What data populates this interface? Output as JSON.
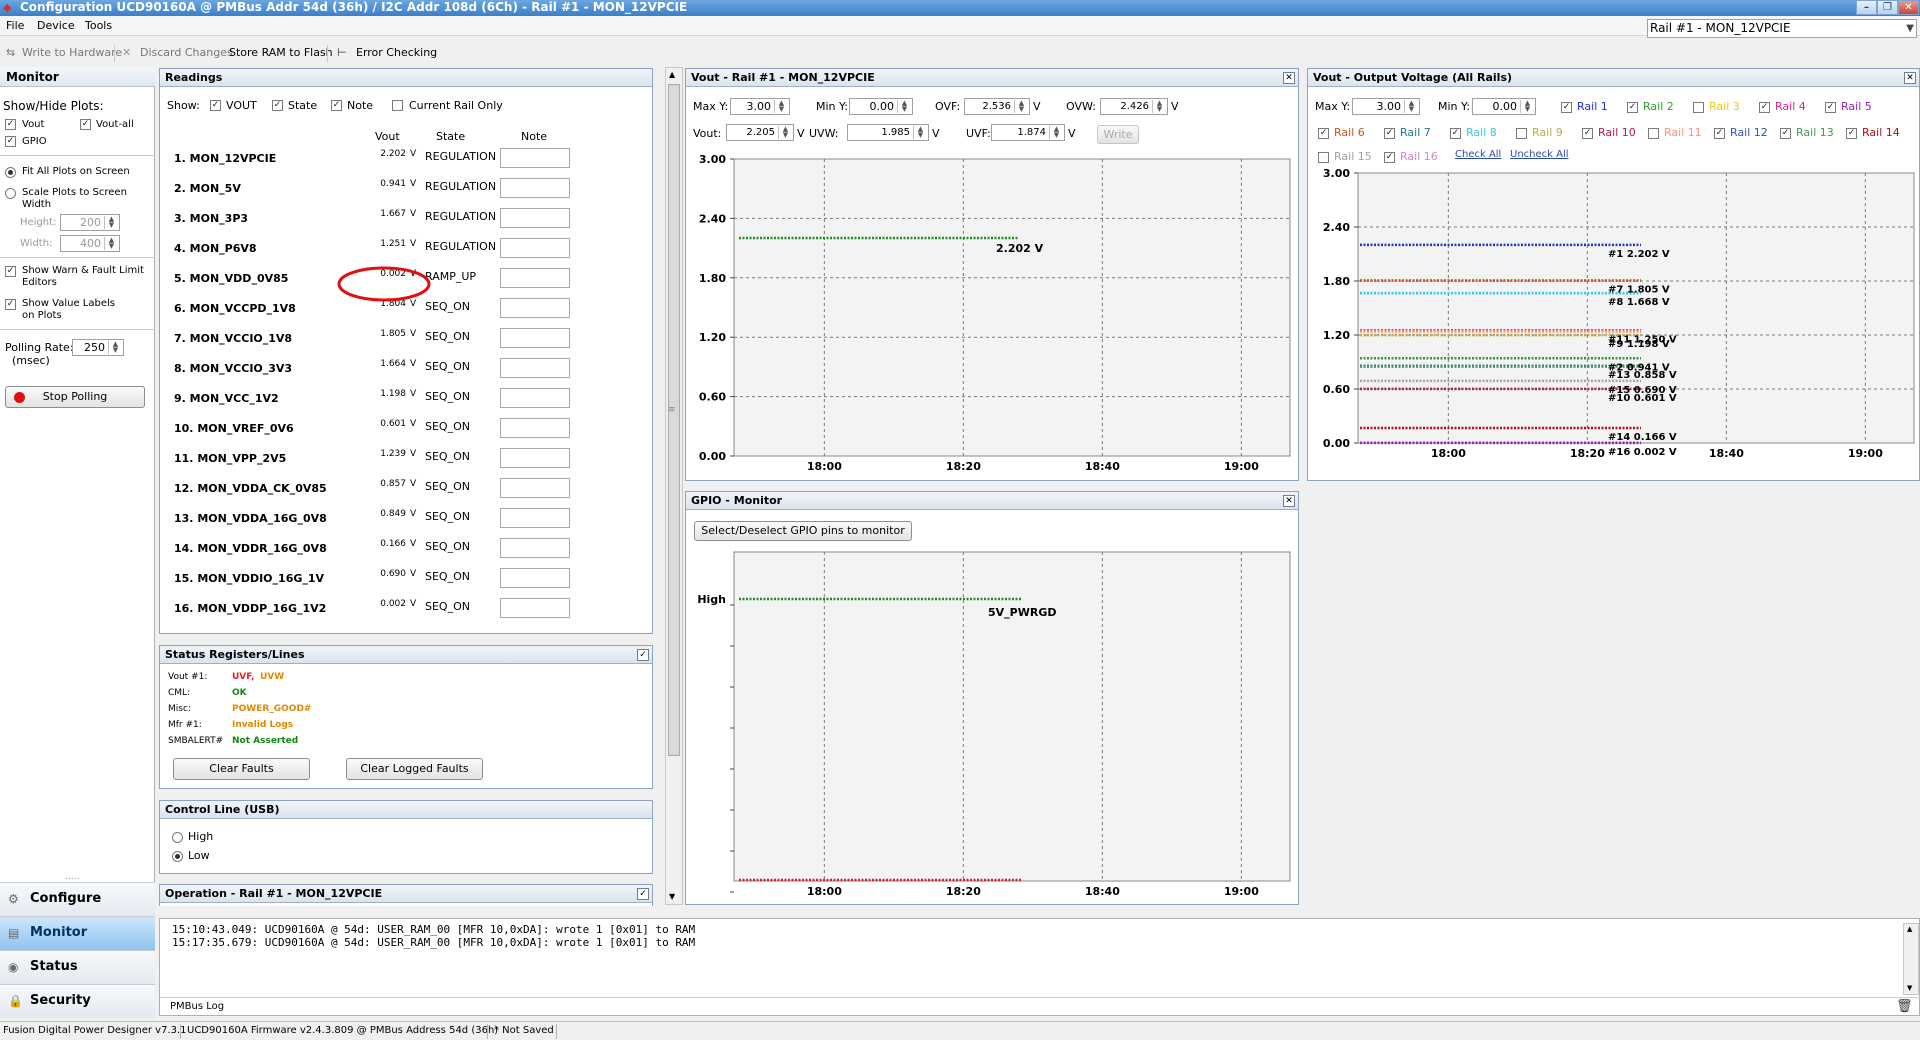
{
  "window": {
    "title": "Configuration UCD90160A @ PMBus Addr 54d (36h) / I2C Addr 108d (6Ch)  - Rail #1 - MON_12VPCIE",
    "minimize": "–",
    "restore": "❐",
    "close": "✕"
  },
  "menu": {
    "file": "File",
    "device": "Device",
    "tools": "Tools"
  },
  "rail_selector": {
    "value": "Rail #1 - MON_12VPCIE"
  },
  "toolbar": {
    "write_to_hardware": "Write to Hardware",
    "discard_changes": "Discard Changes",
    "store_ram_to_flash": "Store RAM to Flash",
    "error_checking": "Error Checking"
  },
  "left": {
    "header": "Monitor",
    "show_hide_label": "Show/Hide Plots:",
    "cb_vout": "Vout",
    "cb_voutall": "Vout-all",
    "cb_gpio": "GPIO",
    "fit_all": "Fit All Plots on Screen",
    "scale_plots": "Scale Plots to Screen",
    "scale_plots2": "Width",
    "height_label": "Height:",
    "height_value": "200",
    "width_label": "Width:",
    "width_value": "400",
    "warn_fault": "Show Warn & Fault Limit",
    "warn_fault2": "Editors",
    "value_labels": "Show Value Labels",
    "value_labels2": "on Plots",
    "polling_label": "Polling Rate:",
    "polling_unit": "(msec)",
    "polling_value": "250",
    "stop_polling": "Stop Polling",
    "grip": "....."
  },
  "nav": {
    "configure": "Configure",
    "monitor": "Monitor",
    "status": "Status",
    "security": "Security"
  },
  "readings": {
    "title": "Readings",
    "show_label": "Show:",
    "show_vout": "VOUT",
    "show_state": "State",
    "show_note": "Note",
    "show_current": "Current Rail Only",
    "col_vout": "Vout",
    "col_state": "State",
    "col_note": "Note",
    "unit": "V",
    "rows": [
      {
        "name": "1. MON_12VPCIE",
        "vout": "2.202",
        "state": "REGULATION"
      },
      {
        "name": "2. MON_5V",
        "vout": "0.941",
        "state": "REGULATION"
      },
      {
        "name": "3. MON_3P3",
        "vout": "1.667",
        "state": "REGULATION"
      },
      {
        "name": "4. MON_P6V8",
        "vout": "1.251",
        "state": "REGULATION"
      },
      {
        "name": "5. MON_VDD_0V85",
        "vout": "0.002",
        "state": "RAMP_UP"
      },
      {
        "name": "6. MON_VCCPD_1V8",
        "vout": "1.804",
        "state": "SEQ_ON"
      },
      {
        "name": "7. MON_VCCIO_1V8",
        "vout": "1.805",
        "state": "SEQ_ON"
      },
      {
        "name": "8. MON_VCCIO_3V3",
        "vout": "1.664",
        "state": "SEQ_ON"
      },
      {
        "name": "9. MON_VCC_1V2",
        "vout": "1.198",
        "state": "SEQ_ON"
      },
      {
        "name": "10. MON_VREF_0V6",
        "vout": "0.601",
        "state": "SEQ_ON"
      },
      {
        "name": "11. MON_VPP_2V5",
        "vout": "1.239",
        "state": "SEQ_ON"
      },
      {
        "name": "12. MON_VDDA_CK_0V85",
        "vout": "0.857",
        "state": "SEQ_ON"
      },
      {
        "name": "13. MON_VDDA_16G_0V8",
        "vout": "0.849",
        "state": "SEQ_ON"
      },
      {
        "name": "14. MON_VDDR_16G_0V8",
        "vout": "0.166",
        "state": "SEQ_ON"
      },
      {
        "name": "15. MON_VDDIO_16G_1V",
        "vout": "0.690",
        "state": "SEQ_ON"
      },
      {
        "name": "16. MON_VDDP_16G_1V2",
        "vout": "0.002",
        "state": "SEQ_ON"
      }
    ]
  },
  "status_regs": {
    "title": "Status Registers/Lines",
    "vout_label": "Vout #1:",
    "vout_v1": "UVF,",
    "vout_v2": "UVW",
    "cml_label": "CML:",
    "cml_value": "OK",
    "misc_label": "Misc:",
    "misc_value": "POWER_GOOD#",
    "mfr_label": "Mfr #1:",
    "mfr_value": "Invalid Logs",
    "smb_label": "SMBALERT#",
    "smb_value": "Not Asserted",
    "clear_faults": "Clear Faults",
    "clear_logged": "Clear Logged Faults",
    "colors": {
      "red": "#dd2222",
      "orange": "#e08800",
      "green": "#118811"
    }
  },
  "control_line": {
    "title": "Control Line (USB)",
    "high": "High",
    "low": "Low"
  },
  "operation": {
    "title": "Operation - Rail #1 - MON_12VPCIE"
  },
  "vout_plot": {
    "title": "Vout - Rail #1 - MON_12VPCIE",
    "maxy_label": "Max Y:",
    "maxy": "3.00",
    "miny_label": "Min Y:",
    "miny": "0.00",
    "ovf_label": "OVF:",
    "ovf": "2.536",
    "ovw_label": "OVW:",
    "ovw": "2.426",
    "vout_label": "Vout:",
    "vout": "2.205",
    "uvw_label": "UVW:",
    "uvw": "1.985",
    "uvf_label": "UVF:",
    "uvf": "1.874",
    "unit": "V",
    "write": "Write",
    "value_label": "2.202 V"
  },
  "gpio_plot": {
    "title": "GPIO - Monitor",
    "select_button": "Select/Deselect GPIO pins to monitor",
    "high_label": "High",
    "signal_label": "5V_PWRGD"
  },
  "all_plot": {
    "title": "Vout - Output Voltage (All Rails)",
    "maxy_label": "Max Y:",
    "maxy": "3.00",
    "miny_label": "Min Y:",
    "miny": "0.00",
    "check_all": "Check All",
    "uncheck_all": "Uncheck All",
    "rails": [
      {
        "label": "Rail 1",
        "color": "#2233cc",
        "checked": true
      },
      {
        "label": "Rail 2",
        "color": "#339933",
        "checked": true
      },
      {
        "label": "Rail 3",
        "color": "#e8c820",
        "checked": false
      },
      {
        "label": "Rail 4",
        "color": "#dd2288",
        "checked": true
      },
      {
        "label": "Rail 5",
        "color": "#9922bb",
        "checked": true
      },
      {
        "label": "Rail 6",
        "color": "#cc5522",
        "checked": true
      },
      {
        "label": "Rail 7",
        "color": "#227788",
        "checked": true
      },
      {
        "label": "Rail 8",
        "color": "#33ccdd",
        "checked": true
      },
      {
        "label": "Rail 9",
        "color": "#bbaa55",
        "checked": false
      },
      {
        "label": "Rail 10",
        "color": "#aa2244",
        "checked": true
      },
      {
        "label": "Rail 11",
        "color": "#ee9977",
        "checked": false
      },
      {
        "label": "Rail 12",
        "color": "#3355aa",
        "checked": true
      },
      {
        "label": "Rail 13",
        "color": "#449955",
        "checked": true
      },
      {
        "label": "Rail 14",
        "color": "#aa1111",
        "checked": true
      },
      {
        "label": "Rail 15",
        "color": "#99aa99",
        "checked": false
      },
      {
        "label": "Rail 16",
        "color": "#cc88cc",
        "checked": true
      }
    ],
    "value_labels": [
      "#1 2.202 V",
      "#7 1.805 V",
      "#8 1.668 V",
      "#11 1.250 V",
      "#9 1.198 V",
      "#2 0.941 V",
      "#13 0.858 V",
      "#15 0.690 V",
      "#10 0.601 V",
      "#14 0.166 V",
      "#16 0.002 V"
    ]
  },
  "chart_data": [
    {
      "type": "line",
      "title": "Vout - Rail #1 - MON_12VPCIE",
      "ylim": [
        0,
        3
      ],
      "yticks": [
        "3.00",
        "2.40",
        "1.80",
        "1.20",
        "0.60",
        "0.00"
      ],
      "xticks": [
        "18:00",
        "18:20",
        "18:40",
        "19:00"
      ],
      "series": [
        {
          "name": "Rail #1",
          "color": "#228822",
          "x": [
            "17:54",
            "18:30"
          ],
          "values": [
            2.202,
            2.202
          ]
        }
      ]
    },
    {
      "type": "line",
      "title": "GPIO - Monitor",
      "xticks": [
        "18:00",
        "18:20",
        "18:40",
        "19:00"
      ],
      "yticks": [
        "High"
      ],
      "series": [
        {
          "name": "5V_PWRGD",
          "color": "#228822",
          "x": [
            "17:54",
            "18:30"
          ],
          "values": [
            1,
            1
          ]
        },
        {
          "color": "#cc2222",
          "x": [
            "17:54",
            "18:30"
          ],
          "values": [
            0,
            0
          ]
        }
      ]
    },
    {
      "type": "line",
      "title": "Vout - Output Voltage (All Rails)",
      "ylim": [
        0,
        3
      ],
      "yticks": [
        "3.00",
        "2.40",
        "1.80",
        "1.20",
        "0.60",
        "0.00"
      ],
      "xticks": [
        "18:00",
        "18:20",
        "18:40",
        "19:00"
      ],
      "series": [
        {
          "name": "#1",
          "color": "#2233cc",
          "values": [
            2.202,
            2.202
          ]
        },
        {
          "name": "#7",
          "color": "#227788",
          "values": [
            1.805,
            1.805
          ]
        },
        {
          "name": "#6",
          "color": "#cc5522",
          "values": [
            1.804,
            1.804
          ]
        },
        {
          "name": "#3",
          "color": "#e8c820",
          "values": [
            1.667,
            1.667
          ]
        },
        {
          "name": "#8",
          "color": "#33ccdd",
          "values": [
            1.664,
            1.664
          ]
        },
        {
          "name": "#4",
          "color": "#dd2288",
          "values": [
            1.251,
            1.251
          ]
        },
        {
          "name": "#11",
          "color": "#ee9977",
          "values": [
            1.239,
            1.239
          ]
        },
        {
          "name": "#9",
          "color": "#bbaa55",
          "values": [
            1.198,
            1.198
          ]
        },
        {
          "name": "#2",
          "color": "#339933",
          "values": [
            0.941,
            0.941
          ]
        },
        {
          "name": "#12",
          "color": "#3355aa",
          "values": [
            0.857,
            0.857
          ]
        },
        {
          "name": "#13",
          "color": "#449955",
          "values": [
            0.849,
            0.849
          ]
        },
        {
          "name": "#15",
          "color": "#99aa99",
          "values": [
            0.69,
            0.69
          ]
        },
        {
          "name": "#10",
          "color": "#aa2244",
          "values": [
            0.601,
            0.601
          ]
        },
        {
          "name": "#14",
          "color": "#aa1111",
          "values": [
            0.166,
            0.166
          ]
        },
        {
          "name": "#16",
          "color": "#cc88cc",
          "values": [
            0.002,
            0.002
          ]
        },
        {
          "name": "#5",
          "color": "#9922bb",
          "values": [
            0.002,
            0.002
          ]
        }
      ]
    }
  ],
  "log": {
    "line1": "15:10:43.049: UCD90160A @ 54d: USER_RAM_00 [MFR 10,0xDA]: wrote 1 [0x01] to RAM",
    "line2": "15:17:35.679: UCD90160A @ 54d: USER_RAM_00 [MFR 10,0xDA]: wrote 1 [0x01] to RAM",
    "tab": "PMBus Log"
  },
  "statusbar": {
    "app": "Fusion Digital Power Designer v7.3.1",
    "fw": "UCD90160A Firmware v2.4.3.809 @ PMBus Address 54d (36h)",
    "saved": "* Not Saved"
  }
}
